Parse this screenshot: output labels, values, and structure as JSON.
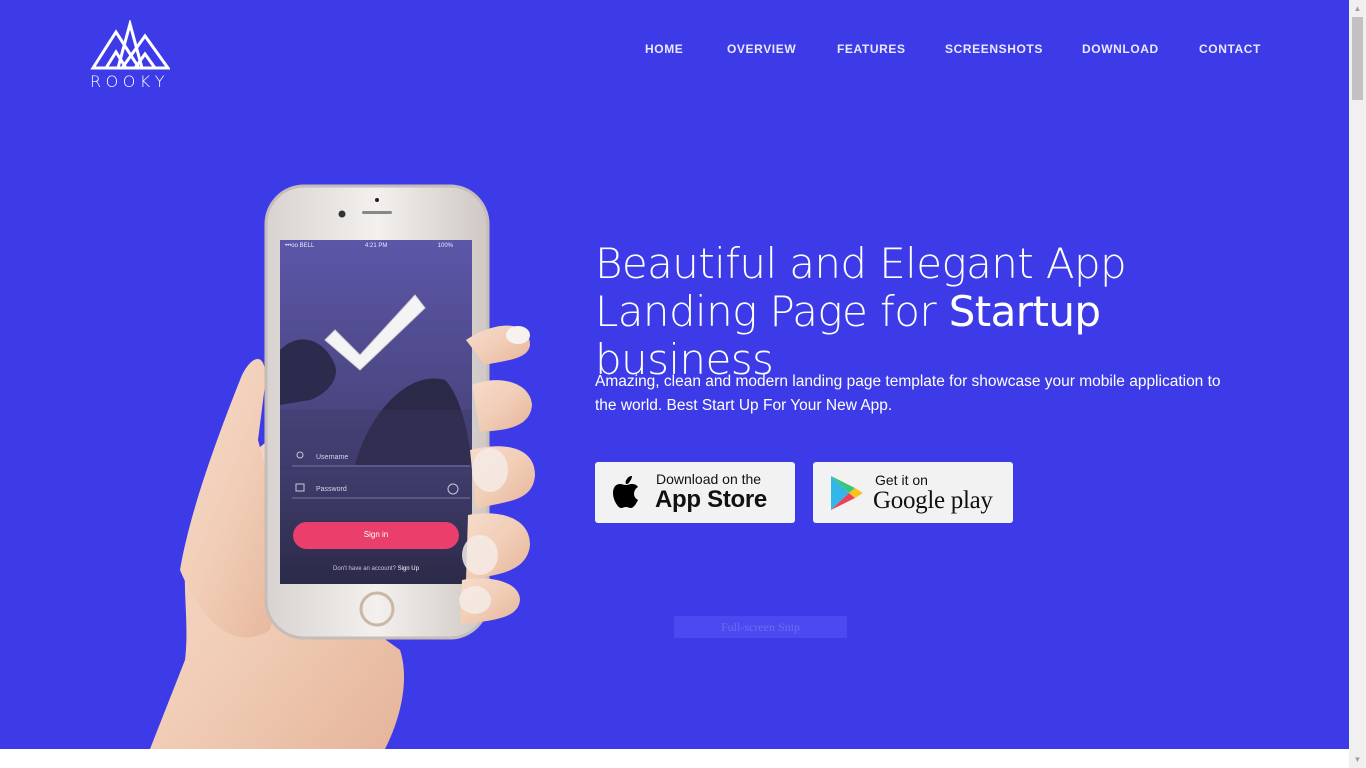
{
  "brand": {
    "logo_text": "ROOKY"
  },
  "nav": {
    "items": [
      "HOME",
      "OVERVIEW",
      "FEATURES",
      "SCREENSHOTS",
      "DOWNLOAD",
      "CONTACT"
    ]
  },
  "hero": {
    "headline_part1": "Beautiful and Elegant App Landing Page for ",
    "headline_strong": "Startup",
    "headline_part2": " business",
    "subtext": "Amazing, clean and modern landing page template for showcase your mobile application to the world. Best Start Up For Your New App."
  },
  "store_buttons": {
    "apple_small": "Download on the",
    "apple_big": "App Store",
    "google_small": "Get it on",
    "google_big": "Google play"
  },
  "phone": {
    "carrier": "•••oo BELL",
    "time": "4:21 PM",
    "battery": "100%",
    "username_placeholder": "Username",
    "password_placeholder": "Password",
    "sign_in_label": "Sign in",
    "signup_prompt": "Don't have an account?",
    "signup_link": "Sign Up"
  },
  "overlay": {
    "snip_label": "Full-screen Snip"
  },
  "colors": {
    "hero_bg": "#3d3be8",
    "signin_btn": "#ea3e6b"
  }
}
